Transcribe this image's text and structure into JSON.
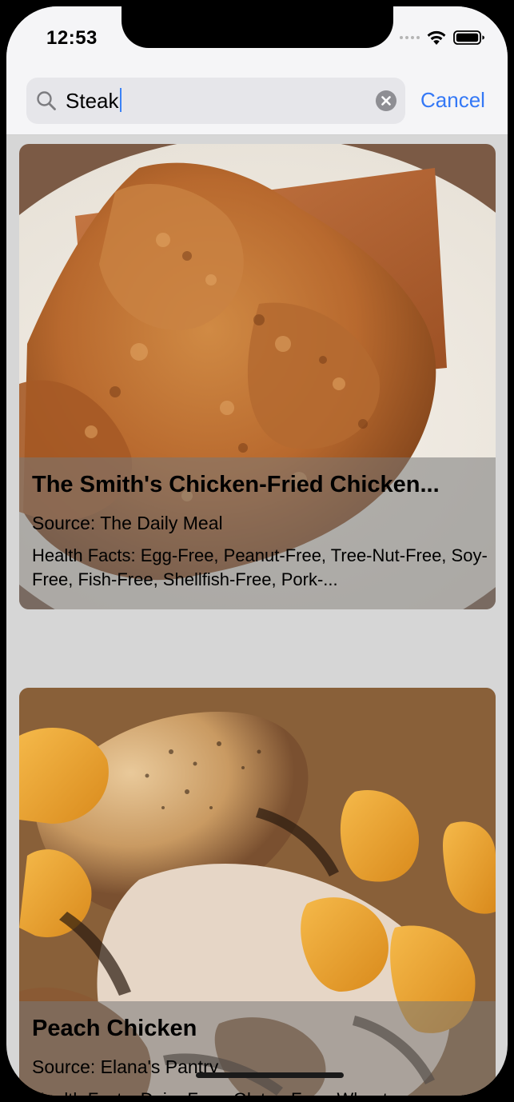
{
  "status_bar": {
    "time": "12:53"
  },
  "search": {
    "query": "Steak",
    "cancel_label": "Cancel"
  },
  "icons": {
    "search": "search-icon",
    "clear": "clear-icon",
    "wifi": "wifi-icon",
    "battery": "battery-icon",
    "signal": "signal-icon"
  },
  "colors": {
    "accent": "#3478f6",
    "screen_background": "#d6d6d6",
    "bar_background": "#f5f5f7"
  },
  "recipes": [
    {
      "title": "The Smith's Chicken-Fried Chicken...",
      "source": "Source: The Daily Meal",
      "health": "Health Facts: Egg-Free, Peanut-Free, Tree-Nut-Free, Soy-Free, Fish-Free, Shellfish-Free, Pork-..."
    },
    {
      "title": "Peach Chicken",
      "source": "Source: Elana's Pantry",
      "health": "Health Facts: Dairy-Free, Gluten-Free, Wheat-"
    }
  ]
}
